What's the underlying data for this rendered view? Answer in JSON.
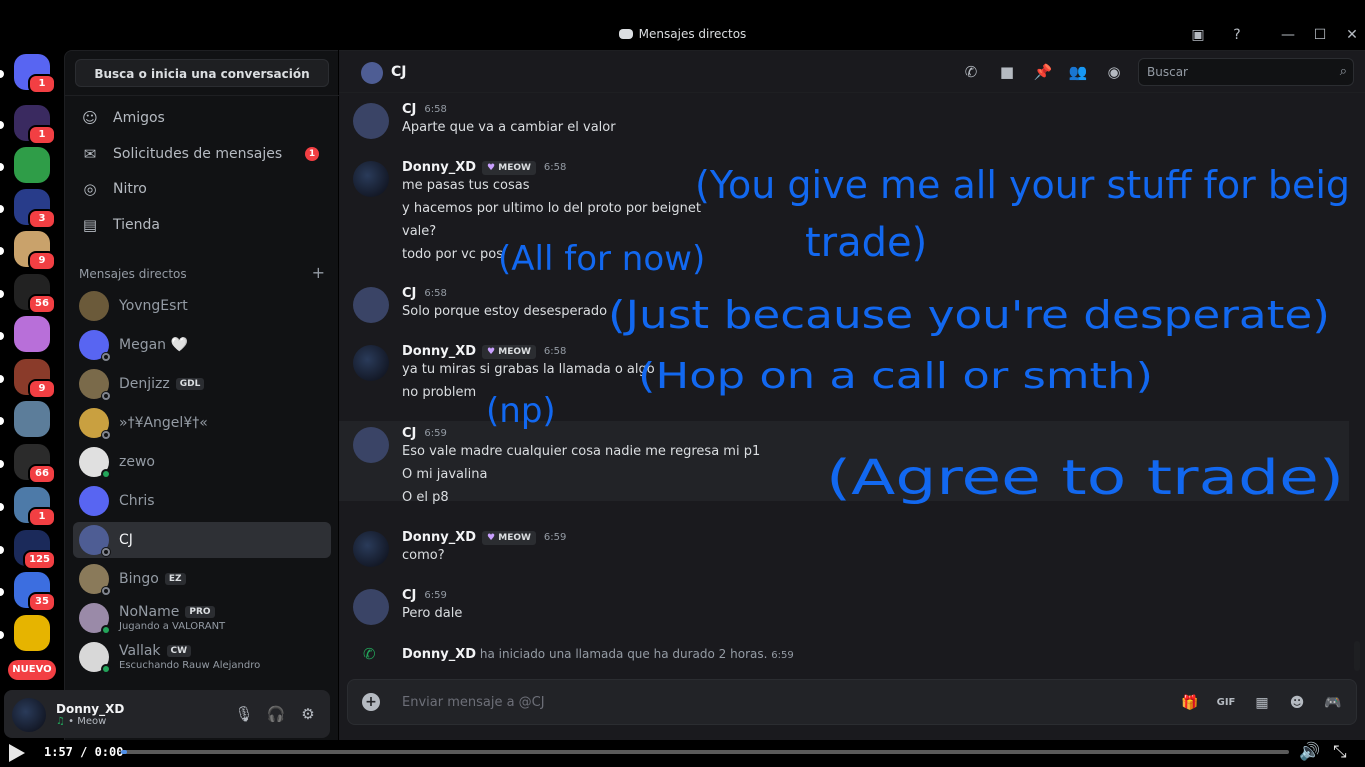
{
  "window": {
    "title": "Mensajes directos"
  },
  "rail": {
    "servers": [
      {
        "name": "discord-home",
        "color": "#5865f2",
        "badge": "1"
      },
      {
        "name": "cheat-plus",
        "color": "#3a2a60",
        "badge": "1"
      },
      {
        "name": "server-3",
        "color": "#2f9d48",
        "badge": ""
      },
      {
        "name": "server-4",
        "color": "#283c8a",
        "badge": "3"
      },
      {
        "name": "server-5",
        "color": "#c9a26b",
        "badge": "9"
      },
      {
        "name": "server-6",
        "color": "#222222",
        "badge": "56"
      },
      {
        "name": "server-7",
        "color": "#b86fd9",
        "badge": ""
      },
      {
        "name": "server-8",
        "color": "#8a3b2a",
        "badge": "9"
      },
      {
        "name": "server-9",
        "color": "#5c7d9a",
        "badge": ""
      },
      {
        "name": "server-10",
        "color": "#2b2b2b",
        "badge": "66"
      },
      {
        "name": "server-11",
        "color": "#4d7aa8",
        "badge": "1"
      },
      {
        "name": "trade",
        "color": "#1b2a5a",
        "badge": "125"
      },
      {
        "name": "server-13",
        "color": "#3c6ee0",
        "badge": "35"
      },
      {
        "name": "jbtn",
        "color": "#e6b400",
        "badge": ""
      }
    ],
    "new_label": "NUEVO"
  },
  "sidebar": {
    "search_label": "Busca o inicia una conversación",
    "nav": [
      {
        "label": "Amigos",
        "icon": "person-wave-icon",
        "badge": ""
      },
      {
        "label": "Solicitudes de mensajes",
        "icon": "envelope-icon",
        "badge": "1"
      },
      {
        "label": "Nitro",
        "icon": "nitro-icon",
        "badge": ""
      },
      {
        "label": "Tienda",
        "icon": "shop-icon",
        "badge": ""
      }
    ],
    "dm_header": "Mensajes directos",
    "dms": [
      {
        "name": "YovngEsrt",
        "tag": "",
        "sub": "",
        "status": "none"
      },
      {
        "name": "Megan 🤍",
        "tag": "",
        "sub": "",
        "status": "offline"
      },
      {
        "name": "Denjizz",
        "tag": "GDL",
        "sub": "",
        "status": "offline"
      },
      {
        "name": "»†¥Angel¥†«",
        "tag": "",
        "sub": "",
        "status": "offline"
      },
      {
        "name": "zewo",
        "tag": "",
        "sub": "",
        "status": "mobile"
      },
      {
        "name": "Chris",
        "tag": "",
        "sub": "",
        "status": "none"
      },
      {
        "name": "CJ",
        "tag": "",
        "sub": "",
        "status": "offline"
      },
      {
        "name": "Bingo",
        "tag": "EZ",
        "sub": "",
        "status": "offline"
      },
      {
        "name": "NoName",
        "tag": "PRO",
        "sub": "Jugando a VALORANT",
        "status": "online"
      },
      {
        "name": "Vallak",
        "tag": "CW",
        "sub": "Escuchando Rauw Alejandro",
        "status": "online"
      }
    ]
  },
  "user_panel": {
    "name": "Donny_XD",
    "status": "• Meow"
  },
  "header": {
    "channel_name": "CJ",
    "search_placeholder": "Buscar"
  },
  "messages": [
    {
      "author": "CJ",
      "tag": "",
      "time": "6:58",
      "lines": [
        "Aparte que va a cambiar el valor"
      ]
    },
    {
      "author": "Donny_XD",
      "tag": "MEOW",
      "time": "6:58",
      "lines": [
        "me pasas tus cosas",
        "y hacemos por ultimo lo del proto por beignet",
        "vale?",
        "todo por vc pos"
      ]
    },
    {
      "author": "CJ",
      "tag": "",
      "time": "6:58",
      "lines": [
        "Solo porque estoy desesperado"
      ]
    },
    {
      "author": "Donny_XD",
      "tag": "MEOW",
      "time": "6:58",
      "lines": [
        "ya tu miras si grabas la llamada o algo",
        "no problem"
      ]
    },
    {
      "author": "CJ",
      "tag": "",
      "time": "6:59",
      "lines": [
        "Eso vale madre cualquier cosa nadie me regresa mi p1",
        "O mi javalina",
        "O el p8"
      ]
    },
    {
      "author": "Donny_XD",
      "tag": "MEOW",
      "time": "6:59",
      "lines": [
        "como?"
      ]
    },
    {
      "author": "CJ",
      "tag": "",
      "time": "6:59",
      "lines": [
        "Pero dale"
      ]
    }
  ],
  "call": {
    "author": "Donny_XD",
    "text": "ha iniciado una llamada que ha durado 2 horas.",
    "time": "6:59"
  },
  "composer": {
    "placeholder": "Enviar mensaje a @CJ"
  },
  "annotations": [
    "(You give me all your stuff for beig",
    "trade)",
    "(All for now)",
    "(Just because you're desperate)",
    "(Hop on a call or smth)",
    "(np)",
    "(Agree to trade)"
  ],
  "video": {
    "time": "1:57 / 0:00",
    "progress_percent": 0.5
  },
  "colors": {
    "annotation_ink": "#1268f0",
    "accent": "#5865f2",
    "online": "#23a55a",
    "badge": "#f23f43"
  }
}
